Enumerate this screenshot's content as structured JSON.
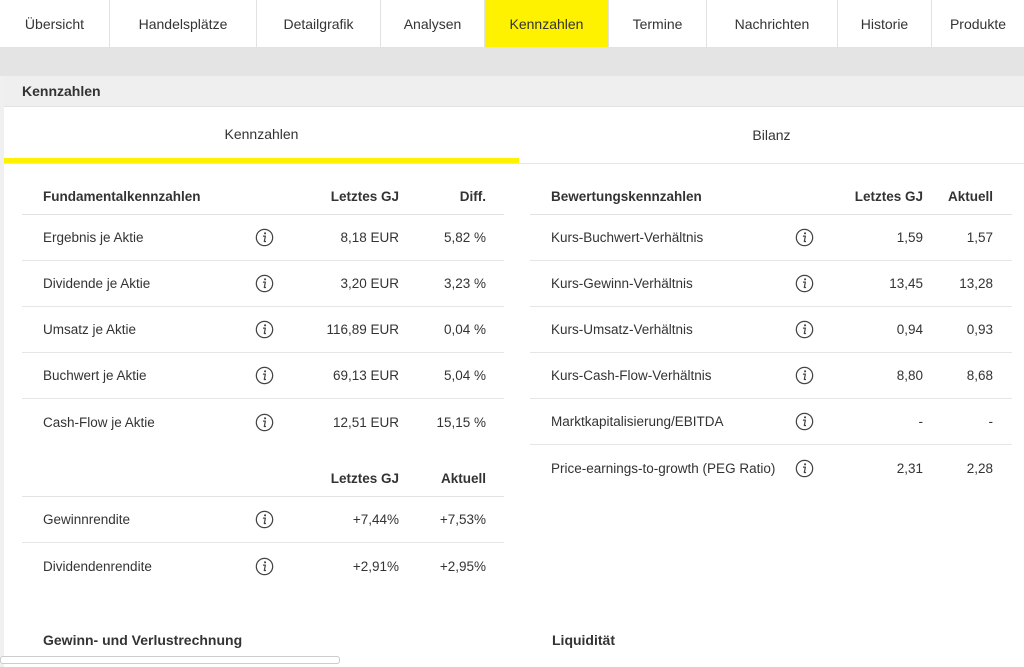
{
  "topnav": {
    "tabs": [
      "Übersicht",
      "Handelsplätze",
      "Detailgrafik",
      "Analysen",
      "Kennzahlen",
      "Termine",
      "Nachrichten",
      "Historie",
      "Produkte"
    ],
    "active": "Kennzahlen"
  },
  "section": {
    "title": "Kennzahlen"
  },
  "subtabs": {
    "items": [
      "Kennzahlen",
      "Bilanz"
    ],
    "active": "Kennzahlen"
  },
  "fundamental": {
    "headers": [
      "Fundamentalkennzahlen",
      "Letztes GJ",
      "Diff."
    ],
    "rows": [
      {
        "label": "Ergebnis je Aktie",
        "last": "8,18 EUR",
        "diff": "5,82 %"
      },
      {
        "label": "Dividende je Aktie",
        "last": "3,20 EUR",
        "diff": "3,23 %"
      },
      {
        "label": "Umsatz je Aktie",
        "last": "116,89 EUR",
        "diff": "0,04 %"
      },
      {
        "label": "Buchwert je Aktie",
        "last": "69,13 EUR",
        "diff": "5,04 %"
      },
      {
        "label": "Cash-Flow je Aktie",
        "last": "12,51 EUR",
        "diff": "15,15 %"
      }
    ]
  },
  "rendite": {
    "headers": [
      "",
      "Letztes GJ",
      "Aktuell"
    ],
    "rows": [
      {
        "label": "Gewinnrendite",
        "last": "+7,44%",
        "current": "+7,53%"
      },
      {
        "label": "Dividendenrendite",
        "last": "+2,91%",
        "current": "+2,95%"
      }
    ]
  },
  "bewertung": {
    "headers": [
      "Bewertungskennzahlen",
      "Letztes GJ",
      "Aktuell"
    ],
    "rows": [
      {
        "label": "Kurs-Buchwert-Verhältnis",
        "last": "1,59",
        "current": "1,57"
      },
      {
        "label": "Kurs-Gewinn-Verhältnis",
        "last": "13,45",
        "current": "13,28"
      },
      {
        "label": "Kurs-Umsatz-Verhältnis",
        "last": "0,94",
        "current": "0,93"
      },
      {
        "label": "Kurs-Cash-Flow-Verhältnis",
        "last": "8,80",
        "current": "8,68"
      },
      {
        "label": "Marktkapitalisierung/EBITDA",
        "last": "-",
        "current": "-"
      },
      {
        "label": "Price-earnings-to-growth (PEG Ratio)",
        "last": "2,31",
        "current": "2,28"
      }
    ]
  },
  "bottom": {
    "left_title": "Gewinn- und Verlustrechnung",
    "right_title": "Liquidität"
  },
  "icons": {
    "info": "info-icon"
  },
  "colors": {
    "accent": "#fff200",
    "border": "#e2e2e2",
    "background": "#f0f0f0"
  }
}
